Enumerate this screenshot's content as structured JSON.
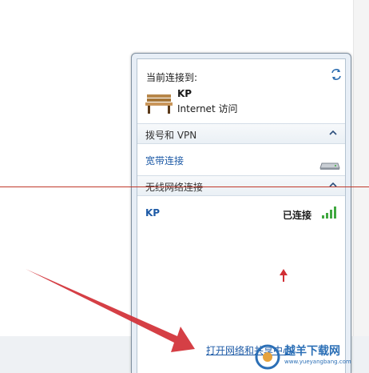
{
  "header": {
    "connected_to_label": "当前连接到:"
  },
  "current_network": {
    "name": "KP",
    "access": "Internet 访问"
  },
  "sections": {
    "dialup": {
      "label": "拨号和 VPN",
      "items": [
        {
          "label": "宽带连接"
        }
      ]
    },
    "wireless": {
      "label": "无线网络连接",
      "networks": [
        {
          "name": "KP",
          "status": "已连接"
        }
      ]
    }
  },
  "footer": {
    "link_label": "打开网络和共享中心"
  },
  "watermark": {
    "text": "越羊下载网",
    "url": "www.yueyangbang.com"
  },
  "colors": {
    "link": "#1d5aa6",
    "arrow": "#d12f35",
    "panel_border": "#7f8f9f"
  },
  "icons": [
    "refresh-icon",
    "bench-network-icon",
    "chevron-up-icon",
    "modem-icon",
    "wifi-signal-icon"
  ]
}
